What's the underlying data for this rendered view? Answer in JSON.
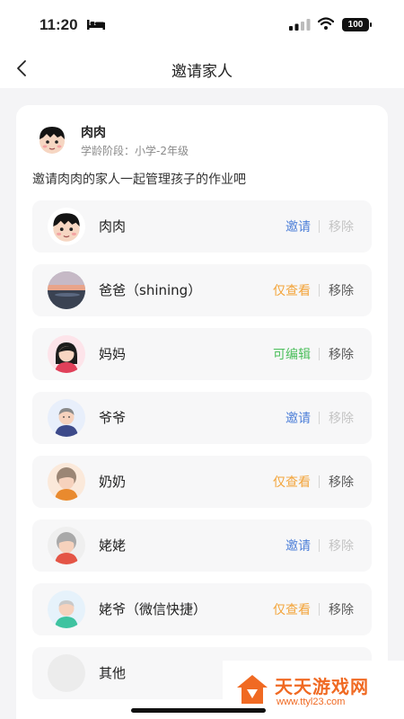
{
  "status": {
    "time": "11:20",
    "battery": "100"
  },
  "header": {
    "title": "邀请家人"
  },
  "child": {
    "name": "肉肉",
    "stage": "学龄阶段：小学-2年级"
  },
  "tip": "邀请肉肉的家人一起管理孩子的作业吧",
  "family": [
    {
      "name": "肉肉",
      "permission": "邀请",
      "permission_color": "#4f80d8",
      "remove": "移除",
      "remove_color": "#c4c4c4"
    },
    {
      "name": "爸爸（shining）",
      "permission": "仅查看",
      "permission_color": "#f3a43a",
      "remove": "移除",
      "remove_color": "#5a5a5a"
    },
    {
      "name": "妈妈",
      "permission": "可编辑",
      "permission_color": "#4cbf5c",
      "remove": "移除",
      "remove_color": "#5a5a5a"
    },
    {
      "name": "爷爷",
      "permission": "邀请",
      "permission_color": "#4f80d8",
      "remove": "移除",
      "remove_color": "#c4c4c4"
    },
    {
      "name": "奶奶",
      "permission": "仅查看",
      "permission_color": "#f3a43a",
      "remove": "移除",
      "remove_color": "#5a5a5a"
    },
    {
      "name": "姥姥",
      "permission": "邀请",
      "permission_color": "#4f80d8",
      "remove": "移除",
      "remove_color": "#c4c4c4"
    },
    {
      "name": "姥爷（微信快捷）",
      "permission": "仅查看",
      "permission_color": "#f3a43a",
      "remove": "移除",
      "remove_color": "#5a5a5a"
    },
    {
      "name": "其他"
    }
  ],
  "watermark": {
    "title": "天天游戏网",
    "url": "www.ttyl23.com"
  }
}
